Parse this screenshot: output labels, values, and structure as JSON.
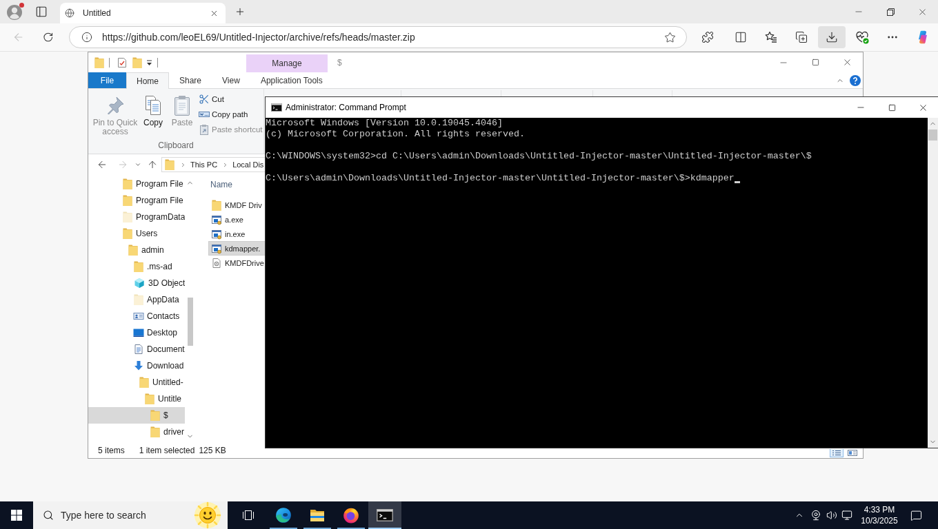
{
  "browser": {
    "tabs": [
      {
        "title": "Untitled",
        "selected": true
      }
    ],
    "back_disabled": true,
    "url": "https://github.com/leoEL69/Untitled-Injector/archive/refs/heads/master.zip",
    "downloads_active": true
  },
  "explorer": {
    "contextual_tab": "Manage",
    "title": "$",
    "ribbon_tabs": [
      {
        "label": "File",
        "kind": "file",
        "selected": false
      },
      {
        "label": "Home",
        "kind": "tab",
        "selected": true
      },
      {
        "label": "Share",
        "kind": "tab",
        "selected": false
      },
      {
        "label": "View",
        "kind": "tab",
        "selected": false
      },
      {
        "label": "Application Tools",
        "kind": "contextual",
        "selected": false
      }
    ],
    "clipboard": {
      "large_buttons": [
        {
          "label": "Pin to Quick access",
          "kind": "pin",
          "disabled": true
        },
        {
          "label": "Copy",
          "kind": "copy",
          "disabled": false
        },
        {
          "label": "Paste",
          "kind": "paste",
          "disabled": true
        }
      ],
      "small_buttons": [
        {
          "label": "Cut",
          "kind": "cut",
          "disabled": false
        },
        {
          "label": "Copy path",
          "kind": "path",
          "disabled": false
        },
        {
          "label": "Paste shortcut",
          "kind": "shortcut",
          "disabled": true
        }
      ],
      "label": "Clipboard"
    },
    "nav_buttons": [
      {
        "kind": "back",
        "disabled": false
      },
      {
        "kind": "forward",
        "disabled": true
      },
      {
        "kind": "recent",
        "disabled": false
      },
      {
        "kind": "up",
        "disabled": false
      }
    ],
    "breadcrumb": [
      "This PC",
      "Local Dis"
    ],
    "tree": [
      {
        "label": "Program File",
        "kind": "folder",
        "selected": false
      },
      {
        "label": "Program File",
        "kind": "folder",
        "selected": false
      },
      {
        "label": "ProgramData",
        "kind": "hidden",
        "selected": false
      },
      {
        "label": "Users",
        "kind": "folder",
        "selected": false,
        "children": [
          {
            "label": "admin",
            "kind": "folder",
            "selected": false,
            "children": [
              {
                "label": ".ms-ad",
                "kind": "folder",
                "selected": false
              },
              {
                "label": "3D Object",
                "kind": "objects",
                "selected": false
              },
              {
                "label": "AppData",
                "kind": "hidden",
                "selected": false
              },
              {
                "label": "Contacts",
                "kind": "contacts",
                "selected": false
              },
              {
                "label": "Desktop",
                "kind": "desktop",
                "selected": false
              },
              {
                "label": "Document",
                "kind": "documents",
                "selected": false
              },
              {
                "label": "Download",
                "kind": "downloads",
                "selected": false,
                "children": [
                  {
                    "label": "Untitled-",
                    "kind": "folder",
                    "selected": false,
                    "children": [
                      {
                        "label": "Untitle",
                        "kind": "folder",
                        "selected": false,
                        "children": [
                          {
                            "label": "$",
                            "kind": "folder",
                            "selected": true
                          },
                          {
                            "label": "driver",
                            "kind": "folder",
                            "selected": false
                          }
                        ]
                      }
                    ]
                  }
                ]
              }
            ]
          }
        ]
      }
    ],
    "files": {
      "column": "Name",
      "items": [
        {
          "name": "KMDF Driv",
          "kind": "folder",
          "selected": false
        },
        {
          "name": "a.exe",
          "kind": "exe",
          "selected": false
        },
        {
          "name": "in.exe",
          "kind": "exe",
          "selected": false
        },
        {
          "name": "kdmapper.",
          "kind": "exe",
          "selected": true
        },
        {
          "name": "KMDFDrive",
          "kind": "settings",
          "selected": false
        }
      ]
    },
    "status": {
      "count": "5 items",
      "selection": "1 item selected",
      "size": "125 KB"
    },
    "view_buttons": [
      {
        "kind": "details",
        "selected": true
      },
      {
        "kind": "tiles",
        "selected": false
      }
    ]
  },
  "console": {
    "title": "Administrator: Command Prompt",
    "paragraphs": [
      [
        "Microsoft Windows [Version 10.0.19045.4046]",
        "(c) Microsoft Corporation. All rights reserved."
      ],
      [
        "C:\\WINDOWS\\system32>cd C:\\Users\\admin\\Downloads\\Untitled-Injector-master\\Untitled-Injector-master\\$"
      ],
      [
        "C:\\Users\\admin\\Downloads\\Untitled-Injector-master\\Untitled-Injector-master\\$>kdmapper"
      ]
    ],
    "cursor": true
  },
  "taskbar": {
    "search_placeholder": "Type here to search",
    "apps": [
      {
        "kind": "edge",
        "running": true,
        "selected": false
      },
      {
        "kind": "explorer",
        "running": true,
        "selected": false
      },
      {
        "kind": "firefox",
        "running": true,
        "selected": false
      },
      {
        "kind": "console",
        "running": true,
        "selected": true
      }
    ],
    "time": "4:33 PM",
    "date": "10/3/2025"
  }
}
